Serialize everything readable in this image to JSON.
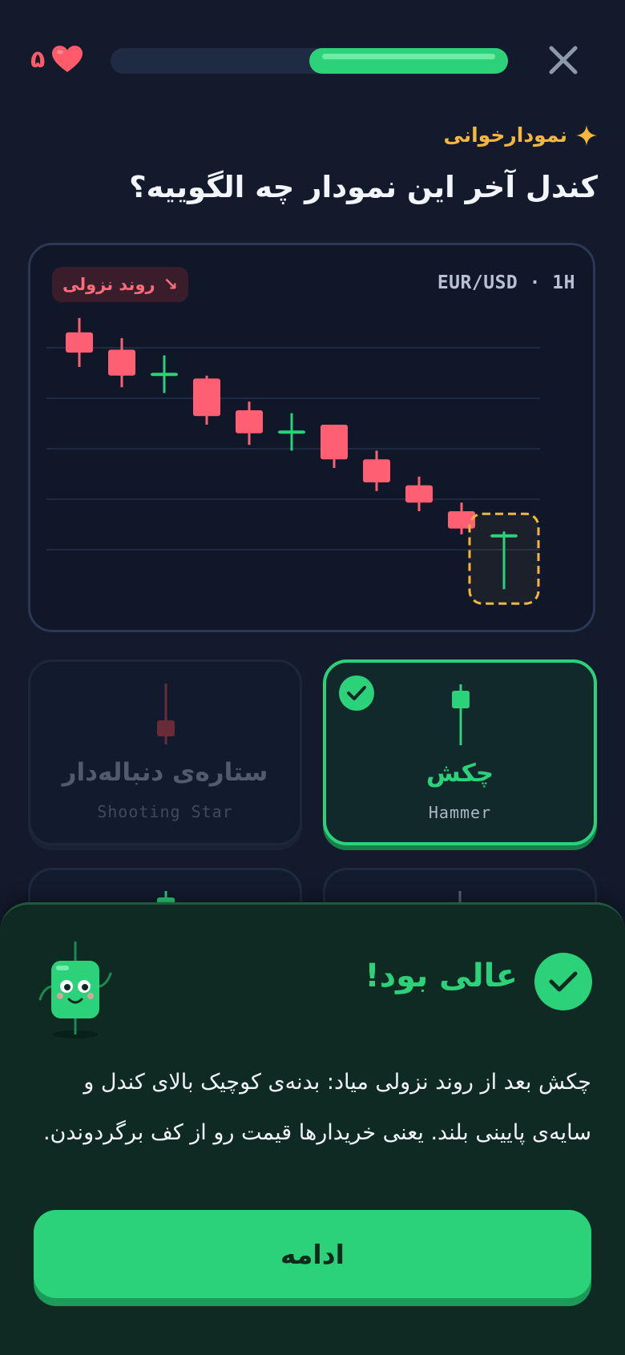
{
  "header": {
    "close_icon": "close-icon",
    "progress_percent": 50,
    "hearts_count": "۵",
    "heart_icon": "heart-icon"
  },
  "lesson": {
    "kicker_icon": "sparkle-icon",
    "kicker": "نمودارخوانی",
    "question": "کندل آخر این نمودار چه الگوییه؟"
  },
  "chart": {
    "trend_badge": "روند نزولی",
    "trend_icon": "arrow-down-right-icon",
    "pair": "EUR/USD · 1H",
    "colors": {
      "bear": "#ff5f72",
      "bull": "#2bd27a",
      "highlight": "#f4b63d"
    }
  },
  "chart_data": {
    "type": "candlestick",
    "candles": [
      {
        "open": 92,
        "close": 85,
        "high": 97,
        "low": 80
      },
      {
        "open": 86,
        "close": 77,
        "high": 90,
        "low": 73
      },
      {
        "open": 78,
        "close": 78,
        "high": 84,
        "low": 71
      },
      {
        "open": 76,
        "close": 63,
        "high": 77,
        "low": 60
      },
      {
        "open": 65,
        "close": 57,
        "high": 68,
        "low": 53
      },
      {
        "open": 58,
        "close": 58,
        "high": 64,
        "low": 51
      },
      {
        "open": 60,
        "close": 48,
        "high": 60,
        "low": 45
      },
      {
        "open": 48,
        "close": 40,
        "high": 51,
        "low": 37
      },
      {
        "open": 39,
        "close": 33,
        "high": 42,
        "low": 30
      },
      {
        "open": 30,
        "close": 24,
        "high": 33,
        "low": 22
      },
      {
        "open": 21,
        "close": 22,
        "high": 23,
        "low": 3
      }
    ],
    "highlighted_index": 10,
    "grid": true
  },
  "options": [
    {
      "name": "چکش",
      "sub": "Hammer",
      "selected": true,
      "state_icon": "check-icon"
    },
    {
      "name": "ستاره‌ی دنباله‌دار",
      "sub": "Shooting Star",
      "selected": false
    }
  ],
  "feedback": {
    "status_icon": "check-icon",
    "title": "عالی بود!",
    "mascot": "candle-mascot-icon",
    "explanation": "چکش بعد از روند نزولی میاد: بدنه‌ی کوچیک بالای کندل و سایه‌ی پایینی بلند. یعنی خریدارها قیمت رو از کف برگردوندن.",
    "continue_label": "ادامه"
  }
}
